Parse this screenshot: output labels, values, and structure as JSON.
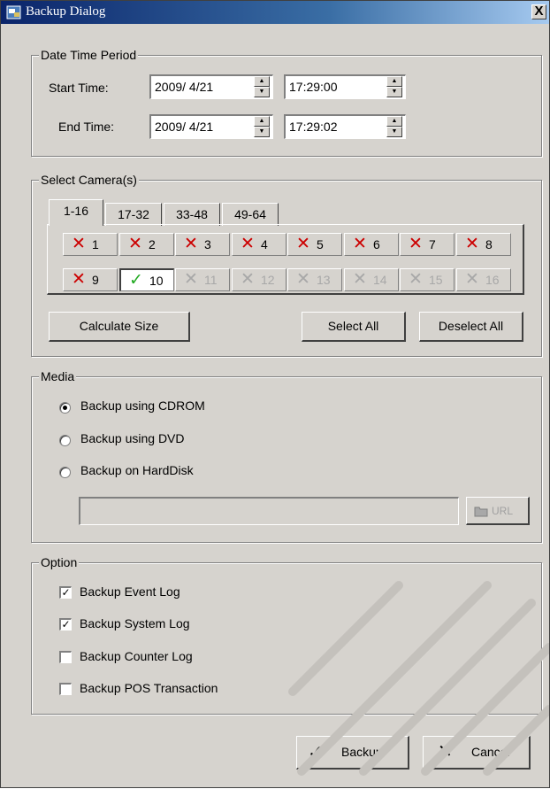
{
  "window": {
    "title": "Backup Dialog",
    "close_glyph": "X"
  },
  "date_time_period": {
    "group_title": "Date Time Period",
    "start_label": "Start Time:",
    "start_date": "2009/  4/21",
    "start_time": "17:29:00",
    "end_label": "End Time:",
    "end_date": "2009/  4/21",
    "end_time": "17:29:02"
  },
  "select_cameras": {
    "group_title": "Select Camera(s)",
    "tabs": [
      {
        "label": "1-16",
        "active": true
      },
      {
        "label": "17-32",
        "active": false
      },
      {
        "label": "33-48",
        "active": false
      },
      {
        "label": "49-64",
        "active": false
      }
    ],
    "cameras": [
      {
        "num": "1",
        "state": "off"
      },
      {
        "num": "2",
        "state": "off"
      },
      {
        "num": "3",
        "state": "off"
      },
      {
        "num": "4",
        "state": "off"
      },
      {
        "num": "5",
        "state": "off"
      },
      {
        "num": "6",
        "state": "off"
      },
      {
        "num": "7",
        "state": "off"
      },
      {
        "num": "8",
        "state": "off"
      },
      {
        "num": "9",
        "state": "off"
      },
      {
        "num": "10",
        "state": "on"
      },
      {
        "num": "11",
        "state": "disabled"
      },
      {
        "num": "12",
        "state": "disabled"
      },
      {
        "num": "13",
        "state": "disabled"
      },
      {
        "num": "14",
        "state": "disabled"
      },
      {
        "num": "15",
        "state": "disabled"
      },
      {
        "num": "16",
        "state": "disabled"
      }
    ],
    "calculate_size": "Calculate Size",
    "select_all": "Select All",
    "deselect_all": "Deselect All"
  },
  "media": {
    "group_title": "Media",
    "options": [
      {
        "label": "Backup using CDROM",
        "selected": true
      },
      {
        "label": "Backup using DVD",
        "selected": false
      },
      {
        "label": "Backup on HardDisk",
        "selected": false
      }
    ],
    "path_value": "",
    "url_button": "URL"
  },
  "option": {
    "group_title": "Option",
    "items": [
      {
        "label": "Backup Event Log",
        "checked": true
      },
      {
        "label": "Backup System Log",
        "checked": true
      },
      {
        "label": "Backup Counter Log",
        "checked": false
      },
      {
        "label": "Backup POS Transaction",
        "checked": false
      }
    ]
  },
  "footer": {
    "backup": "Backup",
    "cancel": "Cancel"
  },
  "icons": {
    "off": "✕",
    "on": "✓",
    "check": "✓",
    "spin_up": "▲",
    "spin_down": "▼"
  },
  "colors": {
    "face": "#d6d3ce",
    "title_start": "#0a246a",
    "off": "#cc0000",
    "on": "#22aa22"
  }
}
